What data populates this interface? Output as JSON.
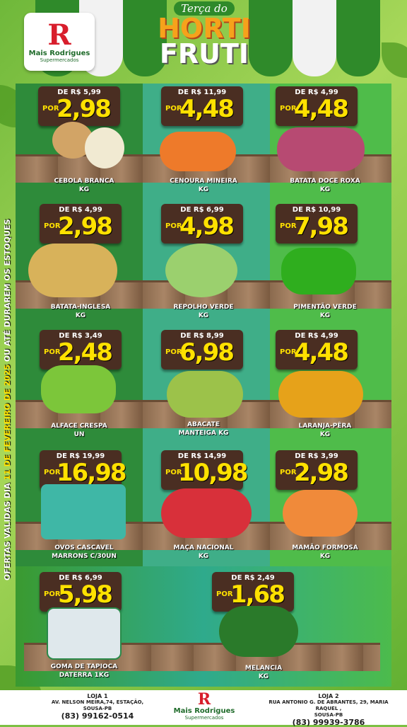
{
  "header": {
    "title_small": "Terça do",
    "title_line1": "HORTI",
    "title_line2": "FRUTI",
    "logo_name": "Mais Rodrigues",
    "logo_sub": "Supermercados"
  },
  "side_text": {
    "prefix": "OFERTAS VALIDAS DIA ",
    "date": "11 DE FEVEREIRO DE 2025",
    "suffix": " OU ATÉ DURAREM OS ESTOQUES"
  },
  "products": [
    {
      "de": "DE R$ 5,99",
      "por": "POR",
      "price": "2,98",
      "name": "CEBOLA BRANCA",
      "unit": "KG"
    },
    {
      "de": "DE R$ 11,99",
      "por": "POR",
      "price": "4,48",
      "name": "CENOURA MINEIRA",
      "unit": "KG"
    },
    {
      "de": "DE R$ 4,99",
      "por": "POR",
      "price": "4,48",
      "name": "BATATA DOCE ROXA",
      "unit": "KG"
    },
    {
      "de": "DE R$ 4,99",
      "por": "POR",
      "price": "2,98",
      "name": "BATATA-INGLESA",
      "unit": "KG"
    },
    {
      "de": "DE R$ 6,99",
      "por": "POR",
      "price": "4,98",
      "name": "REPOLHO VERDE",
      "unit": "KG"
    },
    {
      "de": "DE R$ 10,99",
      "por": "POR",
      "price": "7,98",
      "name": "PIMENTÃO VERDE",
      "unit": "KG"
    },
    {
      "de": "DE R$ 3,49",
      "por": "POR",
      "price": "2,48",
      "name": "ALFACE CRESPA",
      "unit": "UN"
    },
    {
      "de": "DE R$ 8,99",
      "por": "POR",
      "price": "6,98",
      "name": "ABACATE",
      "unit": "MANTEIGA KG"
    },
    {
      "de": "DE R$ 4,99",
      "por": "POR",
      "price": "4,48",
      "name": "LARANJA-PÊRA",
      "unit": "KG"
    },
    {
      "de": "DE R$ 19,99",
      "por": "POR",
      "price": "16,98",
      "name": "OVOS CASCAVEL",
      "unit": "MARRONS C/30UN"
    },
    {
      "de": "DE R$ 14,99",
      "por": "POR",
      "price": "10,98",
      "name": "MAÇA NACIONAL",
      "unit": "KG"
    },
    {
      "de": "DE R$ 3,99",
      "por": "POR",
      "price": "2,98",
      "name": "MAMÃO FORMOSA",
      "unit": "KG"
    },
    {
      "de": "DE R$ 6,99",
      "por": "POR",
      "price": "5,98",
      "name": "GOMA DE TAPIOCA",
      "unit": "DATERRA 1KG"
    },
    {
      "de": "DE R$ 2,49",
      "por": "POR",
      "price": "1,68",
      "name": "MELANCIA",
      "unit": "KG"
    }
  ],
  "footer": {
    "store1": {
      "name": "LOJA 1",
      "address": "AV. NELSON MEIRA,74, ESTAÇÃO,",
      "city": "SOUSA-PB",
      "phone": "(83) 99162-0514"
    },
    "store2": {
      "name": "LOJA  2",
      "address": "RUA ANTONIO G. DE ABRANTES, 29, MARIA RAQUEL ,",
      "city": "SOUSA-PB",
      "phone": "(83) 99939-3786"
    },
    "logo_name": "Mais Rodrigues",
    "logo_sub": "Supermercados"
  },
  "colors": {
    "accent": "#ffe100",
    "price_box": "#4a2e22",
    "brand_red": "#d81e2c",
    "brand_green": "#1f6b2a"
  }
}
